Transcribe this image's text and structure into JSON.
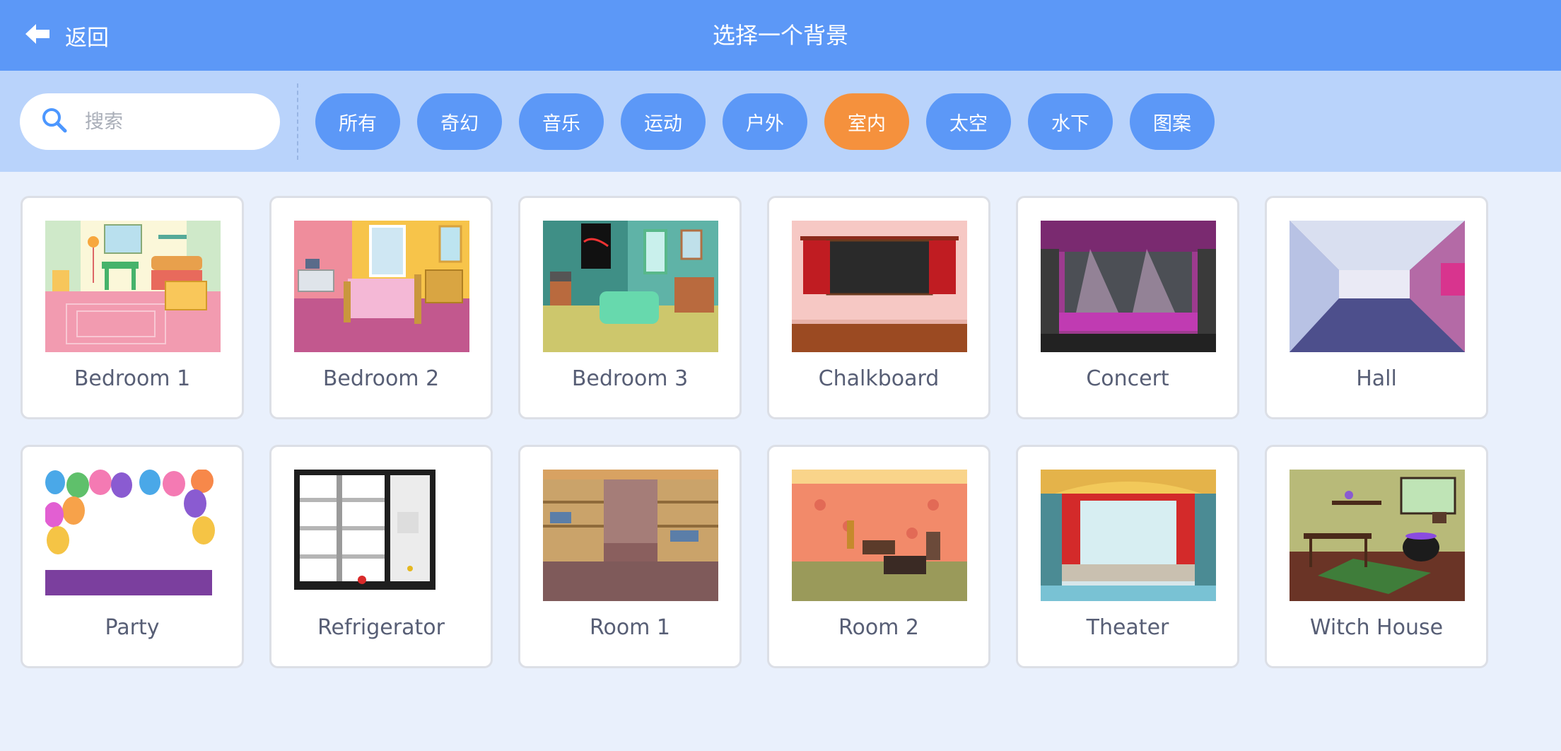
{
  "header": {
    "back_label": "返回",
    "title": "选择一个背景"
  },
  "search": {
    "placeholder": "搜索"
  },
  "tags": [
    "所有",
    "奇幻",
    "音乐",
    "运动",
    "户外",
    "室内",
    "太空",
    "水下",
    "图案"
  ],
  "active_tag": "室内",
  "backdrops": [
    {
      "name": "Bedroom 1"
    },
    {
      "name": "Bedroom 2"
    },
    {
      "name": "Bedroom 3"
    },
    {
      "name": "Chalkboard"
    },
    {
      "name": "Concert"
    },
    {
      "name": "Hall"
    },
    {
      "name": "Party"
    },
    {
      "name": "Refrigerator"
    },
    {
      "name": "Room 1"
    },
    {
      "name": "Room 2"
    },
    {
      "name": "Theater"
    },
    {
      "name": "Witch House"
    }
  ],
  "colors": {
    "header": "#5c98f7",
    "filterbar": "#b9d3fb",
    "active_tag": "#f5913d",
    "tag": "#5c98f7",
    "background": "#e9f0fc"
  }
}
